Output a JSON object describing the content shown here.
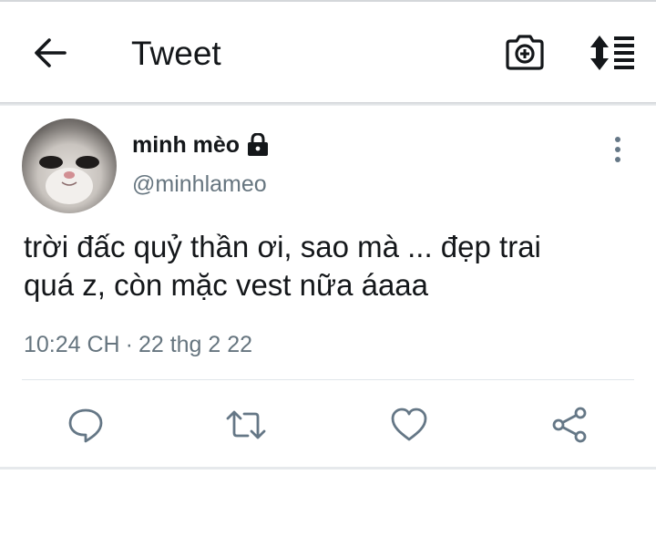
{
  "header": {
    "title": "Tweet",
    "back_icon": "arrow-left-icon",
    "camera_icon": "camera-add-icon",
    "sort_icon": "sort-list-icon"
  },
  "tweet": {
    "author": {
      "name": "minh mèo",
      "handle": "@minhlameo",
      "protected_icon": "lock-icon",
      "avatar": "cat-avatar"
    },
    "text_line_1": "trời đấc quỷ thần ơi, sao mà ... đẹp trai",
    "text_line_2": "quá z, còn mặc vest nữa áaaa",
    "time": "10:24 CH",
    "separator": "·",
    "date": "22 thg 2 22",
    "menu_icon": "more-vertical-icon"
  },
  "actions": [
    {
      "name": "reply",
      "icon": "reply-icon"
    },
    {
      "name": "retweet",
      "icon": "retweet-icon"
    },
    {
      "name": "like",
      "icon": "heart-icon"
    },
    {
      "name": "share",
      "icon": "share-icon"
    }
  ],
  "colors": {
    "text_primary": "#14171a",
    "text_secondary": "#66757f",
    "icon_gray": "#657786",
    "divider": "#e1e6ea"
  }
}
